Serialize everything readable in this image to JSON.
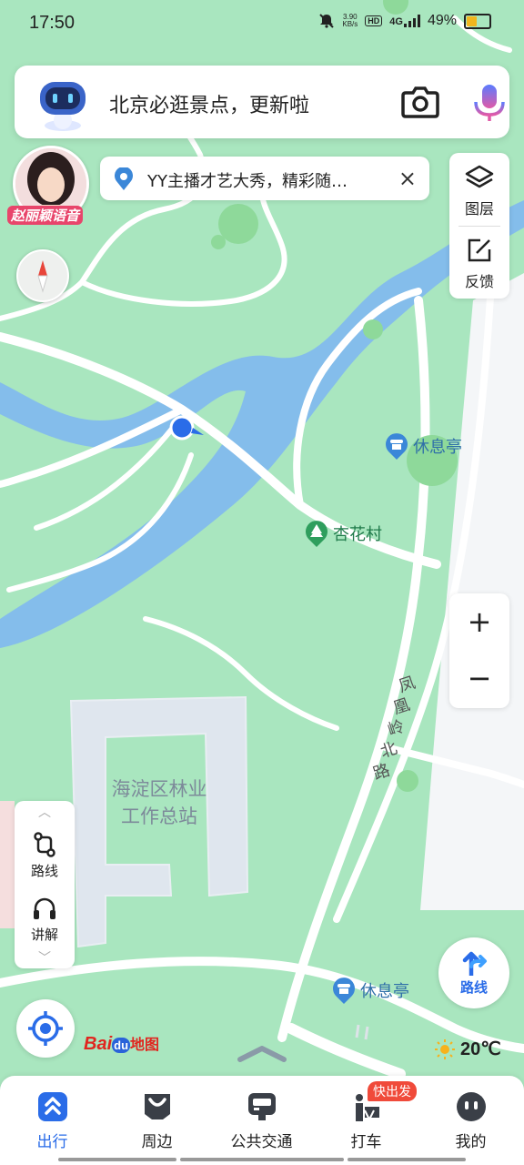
{
  "status_bar": {
    "time": "17:50",
    "network_speed": "3.90",
    "network_speed_unit": "KB/s",
    "hd_badge": "HD",
    "signal": "4G",
    "battery_percent": "49%",
    "battery_level": 0.49
  },
  "search": {
    "query": "北京必逛景点，更新啦",
    "camera_icon": "camera-icon",
    "voice_icon": "microphone-icon"
  },
  "voice_avatar": {
    "label": "赵丽颖语音"
  },
  "notice": {
    "text": "YY主播才艺大秀，精彩随…",
    "close": "×"
  },
  "map_controls": {
    "layers_label": "图层",
    "feedback_label": "反馈",
    "zoom_in": "+",
    "zoom_out": "−"
  },
  "side_panel": {
    "route_label": "路线",
    "guide_label": "讲解"
  },
  "map_labels": {
    "rest_pavilion_1": "休息亭",
    "village": "杏花村",
    "road": [
      "凤",
      "凰",
      "岭",
      "北",
      "路"
    ],
    "area_line1": "海淀区林业",
    "area_line2": "工作总站",
    "rest_pavilion_2": "休息亭"
  },
  "route_button": {
    "label": "路线"
  },
  "logo": {
    "part1": "Bai",
    "part2": "du",
    "part3": "地图"
  },
  "weather": {
    "temperature": "20℃"
  },
  "tab_bar": {
    "tabs": [
      {
        "label": "出行",
        "icon": "travel-icon",
        "active": true
      },
      {
        "label": "周边",
        "icon": "nearby-icon",
        "active": false
      },
      {
        "label": "公共交通",
        "icon": "bus-icon",
        "active": false
      },
      {
        "label": "打车",
        "icon": "taxi-icon",
        "active": false
      },
      {
        "label": "我的",
        "icon": "profile-icon",
        "active": false
      }
    ],
    "taxi_badge": "快出发"
  },
  "colors": {
    "accent": "#2a6ce8",
    "map_green": "#a9e6bf",
    "water": "#7fb8ef"
  }
}
